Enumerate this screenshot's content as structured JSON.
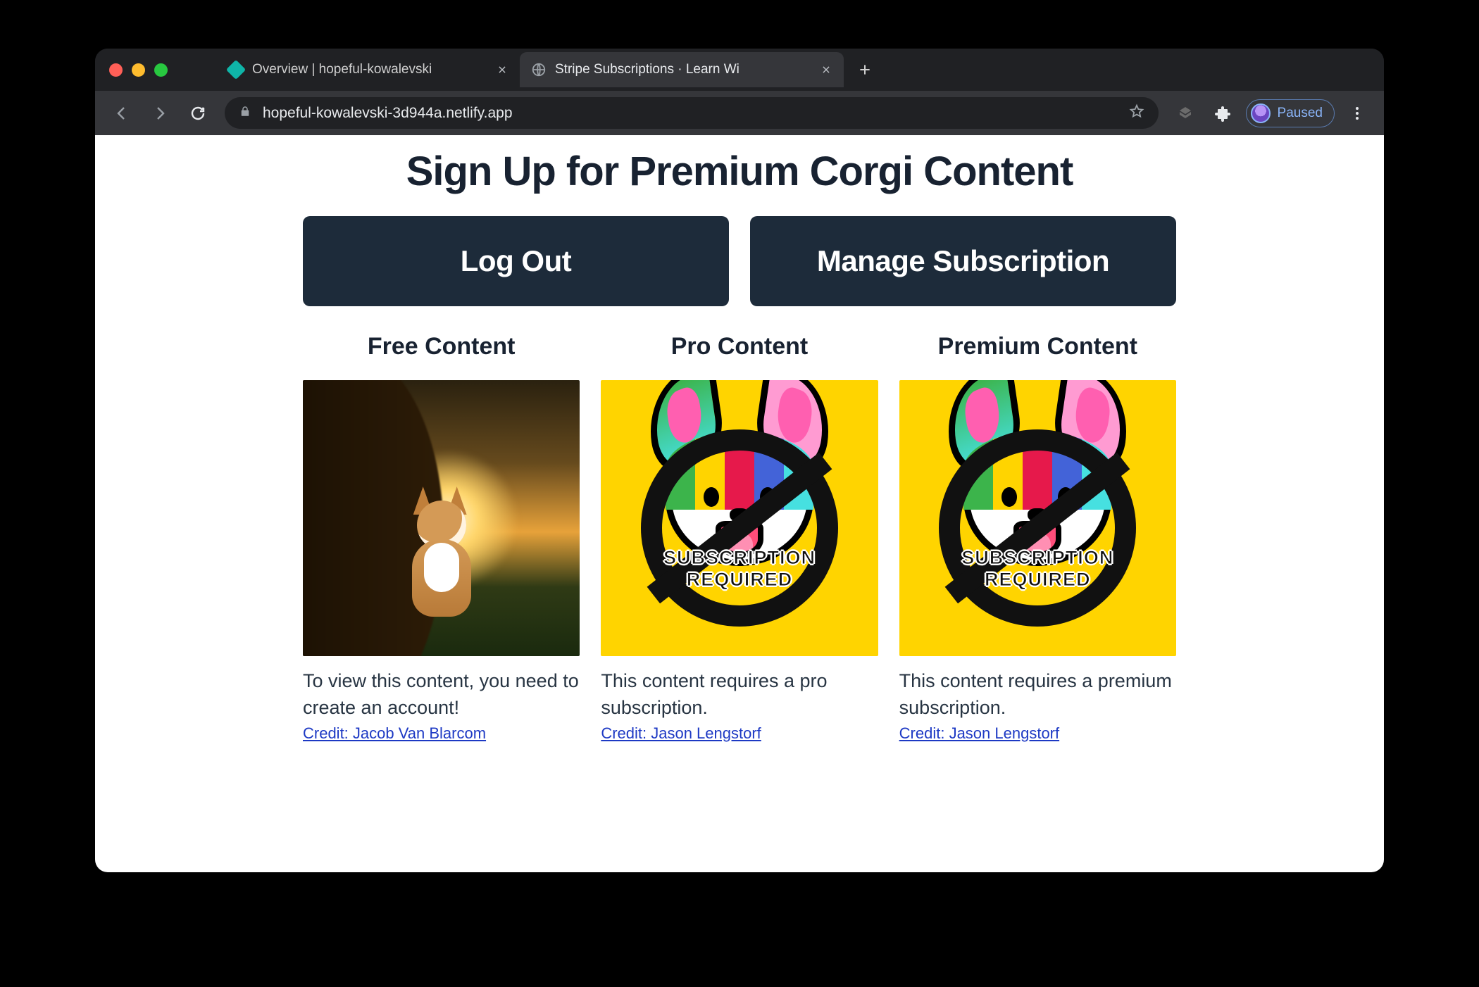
{
  "browser": {
    "tabs": [
      {
        "title": "Overview | hopeful-kowalevski",
        "active": false
      },
      {
        "title": "Stripe Subscriptions · Learn Wi",
        "active": true
      }
    ],
    "url": "hopeful-kowalevski-3d944a.netlify.app",
    "profile_label": "Paused"
  },
  "page": {
    "heading": "Sign Up for Premium Corgi Content",
    "buttons": {
      "logout": "Log Out",
      "manage": "Manage Subscription"
    },
    "cards": [
      {
        "title": "Free Content",
        "caption": "To view this content, you need to create an account!",
        "credit": "Credit: Jacob Van Blarcom",
        "locked": false
      },
      {
        "title": "Pro Content",
        "caption": "This content requires a pro subscription.",
        "credit": "Credit: Jason Lengstorf",
        "locked": true,
        "locked_label": "SUBSCRIPTION REQUIRED"
      },
      {
        "title": "Premium Content",
        "caption": "This content requires a premium subscription.",
        "credit": "Credit: Jason Lengstorf",
        "locked": true,
        "locked_label": "SUBSCRIPTION REQUIRED"
      }
    ]
  }
}
